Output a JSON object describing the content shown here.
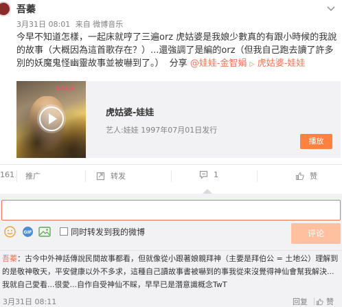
{
  "post": {
    "author": "吾蓁",
    "time": "3月31日 08:01",
    "source_prefix": "来自",
    "source": "微博音乐",
    "text_main": "今早不知道怎樣，一起床就哼了三遍orz 虎姑婆是我娘少數真的有跟小時候的我說的故事（大概因為這首歌存在？）...還強調了是編的orz（但我自己跑去讀了許多別的妖魔鬼怪幽靈故事並被嚇到了。）",
    "share_word": "分享",
    "mention": "@娃娃-金智娟",
    "song_link": "虎姑婆-娃娃"
  },
  "media": {
    "cover_tag": "恶患劫界",
    "title": "虎姑婆-娃娃",
    "meta": "艺人:娃娃  1997年07月01日发行",
    "play_label": "播放"
  },
  "actions": {
    "collect_count": "161",
    "promote": "推广",
    "repost": "转发",
    "comment_count": "1",
    "like": "赞"
  },
  "comment_box": {
    "input_value": "",
    "placeholder": "",
    "repost_label": "同时转发到我的微博",
    "submit_label": "评论"
  },
  "comment": {
    "author": "吾蓁",
    "text": "：古今中外神話傳說民間故事都看，但就像從小跟著娘親拜神（主要是拜伯公 = 土地公）理解到的是敬神敬天，平安健康以外不多求，這種自己讀故事書被嚇到的事我從來沒覺得神仙會幫我解決...我就自己愛看...很愛...自作自受神仙不睬，早早已是潛意識概念TwT",
    "time": "3月31日 08:11",
    "reply_label": "回复",
    "like_label": "赞"
  },
  "colors": {
    "accent": "#eb7350",
    "play_button": "#ff8140",
    "comment_button_disabled": "#ffc09f",
    "panel_bg": "#f2f2f5"
  }
}
